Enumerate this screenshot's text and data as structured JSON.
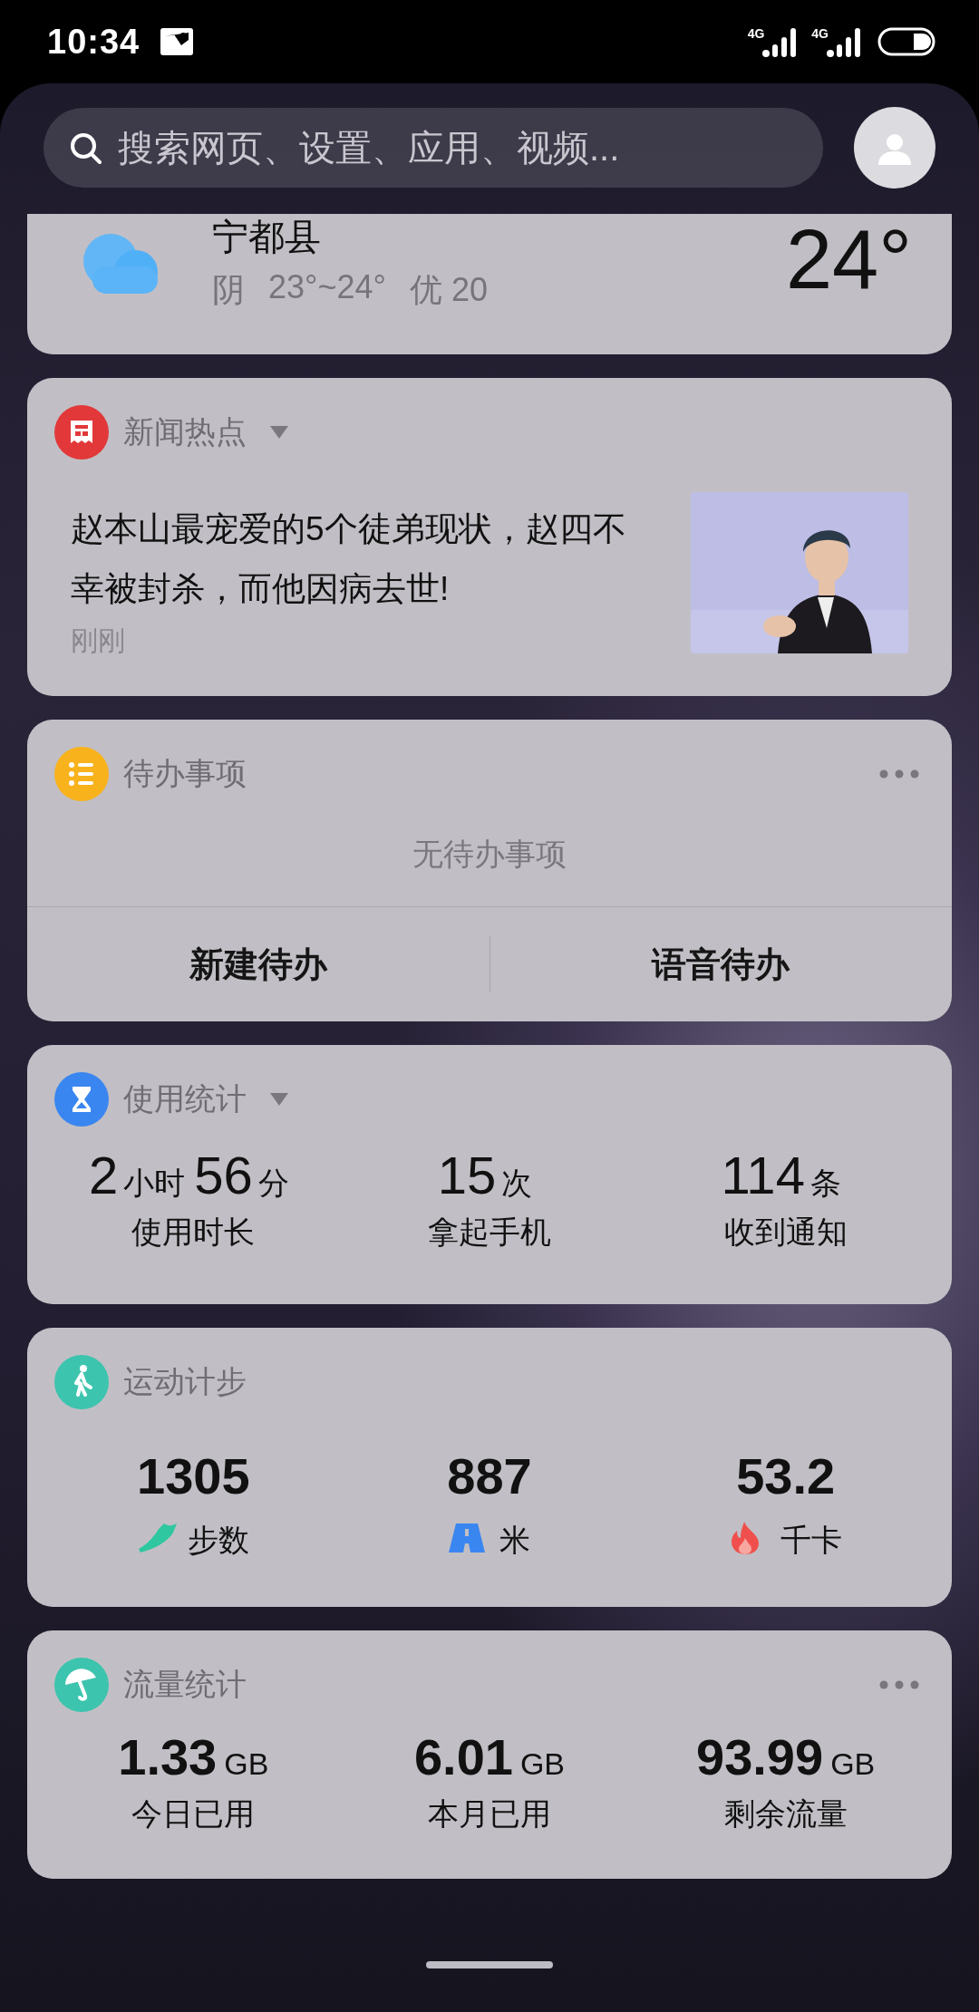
{
  "status_bar": {
    "time": "10:34",
    "networks": [
      "4G",
      "4G"
    ]
  },
  "search": {
    "placeholder": "搜索网页、设置、应用、视频..."
  },
  "weather": {
    "city": "宁都县",
    "condition": "阴",
    "range": "23°~24°",
    "aqi": "优 20",
    "temperature": "24°"
  },
  "news": {
    "title": "新闻热点",
    "headline": "赵本山最宠爱的5个徒弟现状，赵四不幸被封杀，而他因病去世!",
    "time": "刚刚"
  },
  "todo": {
    "title": "待办事项",
    "empty_text": "无待办事项",
    "buttons": [
      "新建待办",
      "语音待办"
    ]
  },
  "usage": {
    "title": "使用统计",
    "stats": [
      {
        "parts": [
          {
            "number": "2",
            "unit": "小时"
          },
          {
            "number": "56",
            "unit": "分"
          }
        ],
        "label": "使用时长"
      },
      {
        "parts": [
          {
            "number": "15",
            "unit": "次"
          }
        ],
        "label": "拿起手机"
      },
      {
        "parts": [
          {
            "number": "114",
            "unit": "条"
          }
        ],
        "label": "收到通知"
      }
    ]
  },
  "steps": {
    "title": "运动计步",
    "stats": [
      {
        "value": "1305",
        "kind": "shoe",
        "label": "步数"
      },
      {
        "value": "887",
        "kind": "road",
        "label": "米"
      },
      {
        "value": "53.2",
        "kind": "flame",
        "label": "千卡"
      }
    ]
  },
  "data_usage": {
    "title": "流量统计",
    "stats": [
      {
        "value": "1.33",
        "unit": "GB",
        "label": "今日已用"
      },
      {
        "value": "6.01",
        "unit": "GB",
        "label": "本月已用"
      },
      {
        "value": "93.99",
        "unit": "GB",
        "label": "剩余流量"
      }
    ]
  }
}
